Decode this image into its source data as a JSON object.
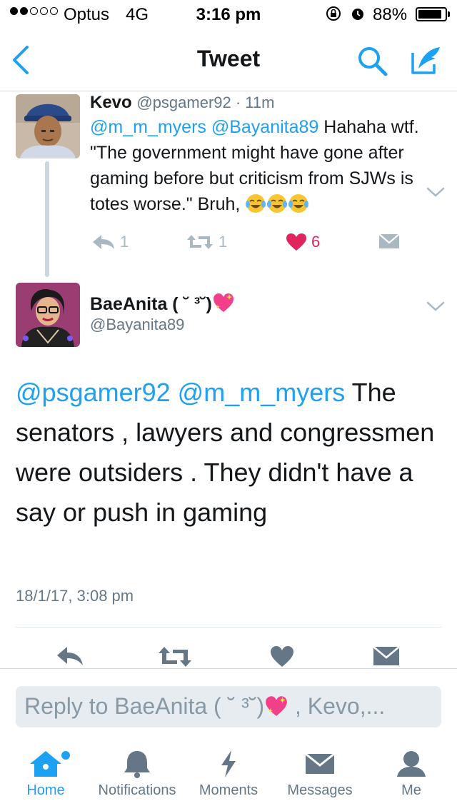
{
  "status_bar": {
    "carrier": "Optus",
    "network": "4G",
    "time": "3:16 pm",
    "battery_percent": "88%",
    "battery_level": 0.88,
    "signal_bars_filled": 2,
    "signal_bars_total": 5
  },
  "nav": {
    "title": "Tweet",
    "back_icon": "chevron-left-icon",
    "search_icon": "search-icon",
    "compose_icon": "compose-icon"
  },
  "parent_tweet": {
    "name": "Kevo",
    "handle_time": "@psgamer92 · 11m",
    "mention_1": "@m_m_myers",
    "mention_2": "@Bayanita89",
    "text_1": " Hahaha wtf. \"The government might have gone after gaming before but criticism from SJWs is totes worse.\" Bruh, ",
    "emoji": "face-with-tears-of-joy x3",
    "reply_count": "1",
    "retweet_count": "1",
    "like_count": "6"
  },
  "focused_tweet": {
    "name": "BaeAnita ( ˘ ³˘)",
    "name_emoji": "sparkling-heart",
    "handle": "@Bayanita89",
    "mention_1": "@psgamer92",
    "mention_2": "@m_m_myers",
    "text": " The senators , lawyers and congressmen were outsiders . They didn't have a say or push in gaming",
    "timestamp": "18/1/17, 3:08 pm"
  },
  "reply_bar": {
    "placeholder_before": "Reply to BaeAnita ( ˘ ³˘)",
    "placeholder_after": " , Kevo,..."
  },
  "tabs": [
    {
      "label": "Home",
      "icon": "home-icon",
      "active": true
    },
    {
      "label": "Notifications",
      "icon": "bell-icon",
      "active": false
    },
    {
      "label": "Moments",
      "icon": "lightning-icon",
      "active": false
    },
    {
      "label": "Messages",
      "icon": "envelope-icon",
      "active": false
    },
    {
      "label": "Me",
      "icon": "person-icon",
      "active": false
    }
  ],
  "colors": {
    "accent": "#1da1f2",
    "text": "#14171a",
    "muted": "#657786",
    "icon_muted": "#aab8c2",
    "like": "#e0245e"
  }
}
